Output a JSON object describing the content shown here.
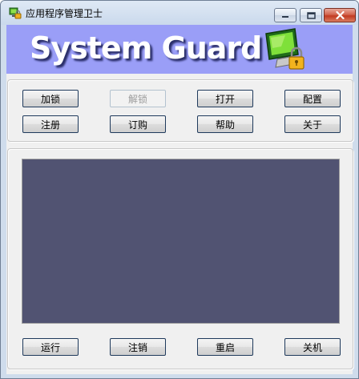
{
  "window": {
    "title": "应用程序管理卫士",
    "app_icon": "shield-app-icon",
    "controls": {
      "minimize": "minimize-icon",
      "maximize": "maximize-icon",
      "close": "close-icon"
    }
  },
  "banner": {
    "title": "System Guard",
    "icon": "monitor-lock-icon",
    "background_color": "#9a9ef7"
  },
  "toolbar": {
    "row1": [
      {
        "label": "加锁",
        "enabled": true
      },
      {
        "label": "解锁",
        "enabled": false
      },
      {
        "label": "打开",
        "enabled": true
      },
      {
        "label": "配置",
        "enabled": true
      }
    ],
    "row2": [
      {
        "label": "注册",
        "enabled": true
      },
      {
        "label": "订购",
        "enabled": true
      },
      {
        "label": "帮助",
        "enabled": true
      },
      {
        "label": "关于",
        "enabled": true
      }
    ]
  },
  "display_panel": {
    "background_color": "#515372"
  },
  "actions": [
    {
      "label": "运行"
    },
    {
      "label": "注销"
    },
    {
      "label": "重启"
    },
    {
      "label": "关机"
    }
  ]
}
